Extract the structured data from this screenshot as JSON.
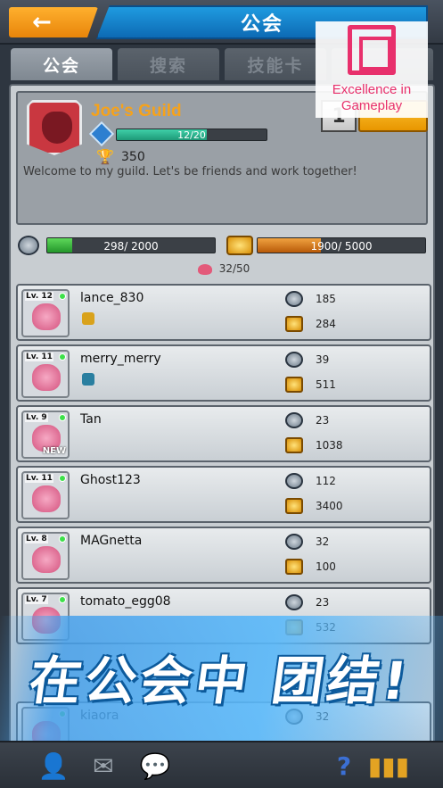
{
  "header": {
    "back_label": "←",
    "title": "公会"
  },
  "tabs": [
    {
      "label": "公会",
      "active": true
    },
    {
      "label": "搜索",
      "active": false
    },
    {
      "label": "技能卡",
      "active": false
    },
    {
      "label": "",
      "active": false
    }
  ],
  "guild": {
    "name": "Joe's Guild",
    "level_progress": "12/20",
    "level_progress_fraction": 0.6,
    "trophies": "350",
    "rank_label": "1",
    "description": "Welcome to my guild. Let's be friends and work together!"
  },
  "resources": {
    "energy": "298/ 2000",
    "energy_fraction": 0.149,
    "coins": "1900/ 5000",
    "coins_fraction": 0.38
  },
  "members_count": "32/50",
  "members": [
    {
      "level": "Lv. 12",
      "name": "lance_830",
      "v1": "185",
      "v2": "284",
      "badge_color": "#d9a21b",
      "new": ""
    },
    {
      "level": "Lv. 11",
      "name": "merry_merry",
      "v1": "39",
      "v2": "511",
      "badge_color": "#2a7fa0",
      "new": ""
    },
    {
      "level": "Lv. 9",
      "name": "Tan",
      "v1": "23",
      "v2": "1038",
      "badge_color": "",
      "new": "NEW"
    },
    {
      "level": "Lv. 11",
      "name": "Ghost123",
      "v1": "112",
      "v2": "3400",
      "badge_color": "",
      "new": ""
    },
    {
      "level": "Lv. 8",
      "name": "MAGnetta",
      "v1": "32",
      "v2": "100",
      "badge_color": "",
      "new": ""
    },
    {
      "level": "Lv. 7",
      "name": "tomato_egg08",
      "v1": "23",
      "v2": "532",
      "badge_color": "",
      "new": ""
    },
    {
      "level": "",
      "name": "kiaora",
      "v1": "32",
      "v2": "",
      "badge_color": "",
      "new": ""
    }
  ],
  "banner": {
    "text": "在公会中 团结!"
  },
  "award": {
    "text": "Excellence in Gameplay"
  },
  "bottom_icons": [
    "add-friend-icon",
    "mail-icon",
    "chat-icon",
    "help-icon",
    "leaderboard-icon"
  ],
  "bottom_glyphs": {
    "help": "?"
  }
}
